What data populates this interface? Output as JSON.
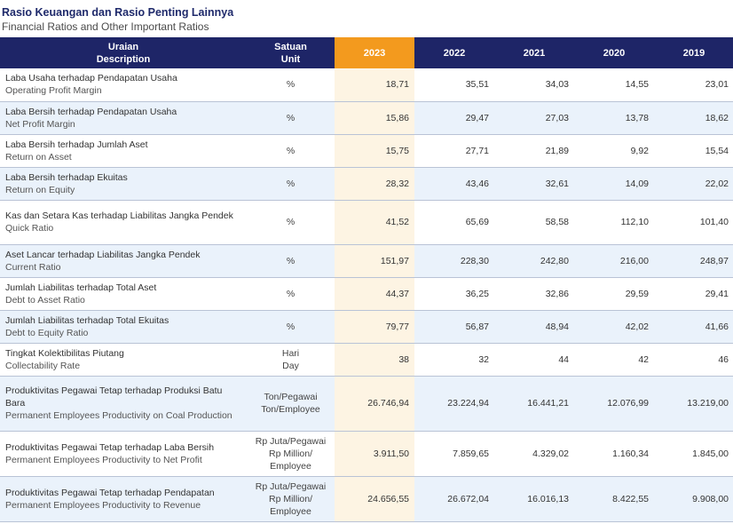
{
  "title": "Rasio Keuangan dan Rasio Penting Lainnya",
  "subtitle": "Financial Ratios and Other Important Ratios",
  "header": {
    "desc_id": "Uraian",
    "desc_en": "Description",
    "unit_id": "Satuan",
    "unit_en": "Unit",
    "years": [
      "2023",
      "2022",
      "2021",
      "2020",
      "2019"
    ]
  },
  "rows": [
    {
      "desc_id": "Laba Usaha terhadap Pendapatan Usaha",
      "desc_en": "Operating Profit Margin",
      "unit": [
        "%"
      ],
      "values": [
        "18,71",
        "35,51",
        "34,03",
        "14,55",
        "23,01"
      ],
      "height": 37
    },
    {
      "desc_id": "Laba Bersih terhadap Pendapatan Usaha",
      "desc_en": "Net Profit Margin",
      "unit": [
        "%"
      ],
      "values": [
        "15,86",
        "29,47",
        "27,03",
        "13,78",
        "18,62"
      ],
      "height": 37
    },
    {
      "desc_id": "Laba Bersih terhadap Jumlah Aset",
      "desc_en": "Return on Asset",
      "unit": [
        "%"
      ],
      "values": [
        "15,75",
        "27,71",
        "21,89",
        "9,92",
        "15,54"
      ],
      "height": 37
    },
    {
      "desc_id": "Laba Bersih terhadap Ekuitas",
      "desc_en": "Return on Equity",
      "unit": [
        "%"
      ],
      "values": [
        "28,32",
        "43,46",
        "32,61",
        "14,09",
        "22,02"
      ],
      "height": 37
    },
    {
      "desc_id": "Kas dan Setara Kas terhadap Liabilitas Jangka Pendek",
      "desc_en": "Quick Ratio",
      "unit": [
        "%"
      ],
      "values": [
        "41,52",
        "65,69",
        "58,58",
        "112,10",
        "101,40"
      ],
      "height": 50
    },
    {
      "desc_id": "Aset Lancar terhadap Liabilitas Jangka Pendek",
      "desc_en": "Current Ratio",
      "unit": [
        "%"
      ],
      "values": [
        "151,97",
        "228,30",
        "242,80",
        "216,00",
        "248,97"
      ],
      "height": 37
    },
    {
      "desc_id": "Jumlah Liabilitas terhadap Total Aset",
      "desc_en": "Debt to Asset Ratio",
      "unit": [
        "%"
      ],
      "values": [
        "44,37",
        "36,25",
        "32,86",
        "29,59",
        "29,41"
      ],
      "height": 37
    },
    {
      "desc_id": "Jumlah Liabilitas terhadap Total Ekuitas",
      "desc_en": "Debt to Equity Ratio",
      "unit": [
        "%"
      ],
      "values": [
        "79,77",
        "56,87",
        "48,94",
        "42,02",
        "41,66"
      ],
      "height": 37
    },
    {
      "desc_id": "Tingkat Kolektibilitas Piutang",
      "desc_en": "Collectability Rate",
      "unit": [
        "Hari",
        "Day"
      ],
      "values": [
        "38",
        "32",
        "44",
        "42",
        "46"
      ],
      "height": 37
    },
    {
      "desc_id": "Produktivitas Pegawai Tetap terhadap Produksi Batu Bara",
      "desc_en": "Permanent Employees Productivity on Coal Production",
      "unit": [
        "Ton/Pegawai",
        "Ton/Employee"
      ],
      "values": [
        "26.746,94",
        "23.224,94",
        "16.441,21",
        "12.076,99",
        "13.219,00"
      ],
      "height": 62
    },
    {
      "desc_id": "Produktivitas Pegawai Tetap terhadap Laba Bersih",
      "desc_en": "Permanent Employees Productivity to Net Profit",
      "unit": [
        "Rp Juta/Pegawai",
        "Rp Million/",
        "Employee"
      ],
      "values": [
        "3.911,50",
        "7.859,65",
        "4.329,02",
        "1.160,34",
        "1.845,00"
      ],
      "height": 51
    },
    {
      "desc_id": "Produktivitas Pegawai Tetap terhadap Pendapatan",
      "desc_en": "Permanent Employees Productivity to Revenue",
      "unit": [
        "Rp Juta/Pegawai",
        "Rp Million/",
        "Employee"
      ],
      "values": [
        "24.656,55",
        "26.672,04",
        "16.016,13",
        "8.422,55",
        "9.908,00"
      ],
      "height": 51
    }
  ]
}
